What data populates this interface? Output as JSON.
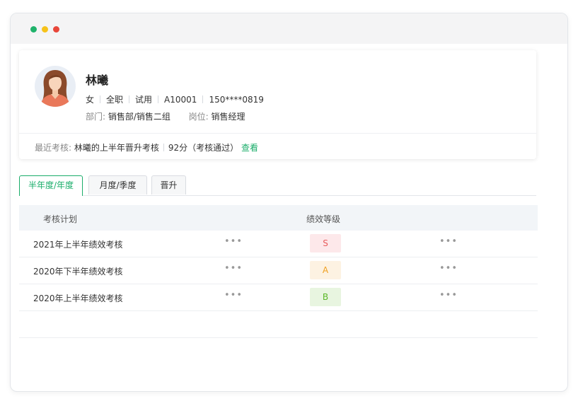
{
  "profile": {
    "name": "林曦",
    "gender": "女",
    "employment": "全职",
    "status": "试用",
    "employee_id": "A10001",
    "phone": "150****0819",
    "dept_label": "部门:",
    "dept_value": "销售部/销售二组",
    "position_label": "岗位:",
    "position_value": "销售经理"
  },
  "recent": {
    "label": "最近考核:",
    "title": "林曦的上半年晋升考核",
    "score": "92分（考核通过）",
    "link": "查看"
  },
  "tabs": [
    {
      "label": "半年度/年度",
      "active": true
    },
    {
      "label": "月度/季度",
      "active": false
    },
    {
      "label": "晋升",
      "active": false
    }
  ],
  "table": {
    "headers": [
      "考核计划",
      "绩效等级"
    ],
    "rows": [
      {
        "plan": "2021年上半年绩效考核",
        "grade": "S",
        "grade_color": "#e85c5c",
        "grade_bg": "#fde8ea"
      },
      {
        "plan": "2020年下半年绩效考核",
        "grade": "A",
        "grade_color": "#f0a020",
        "grade_bg": "#fdf2e2"
      },
      {
        "plan": "2020年上半年绩效考核",
        "grade": "B",
        "grade_color": "#5cb82a",
        "grade_bg": "#e8f5e0"
      }
    ],
    "more_glyph": "•••"
  },
  "colors": {
    "accent": "#1aad6a"
  }
}
